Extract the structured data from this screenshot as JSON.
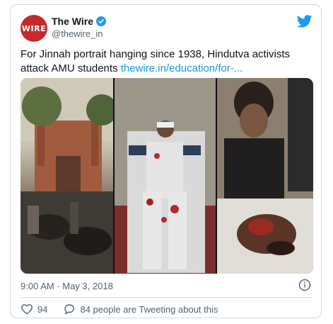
{
  "tweet": {
    "avatar_text": "WIRE",
    "display_name": "The Wire",
    "handle": "@thewire_in",
    "text": "For Jinnah portrait hanging since 1938, Hindutva activists attack AMU students ",
    "link": "thewire.in/education/for-...",
    "timestamp": "9:00 AM · May 3, 2018",
    "likes": "94",
    "reply_text": "84 people are Tweeting about this"
  },
  "colors": {
    "accent": "#1d9bf0",
    "link": "#1b95e0",
    "avatar_bg": "#c8282d"
  },
  "icons": [
    "verified-badge-icon",
    "twitter-bird-icon",
    "info-icon",
    "heart-icon",
    "comment-icon"
  ]
}
